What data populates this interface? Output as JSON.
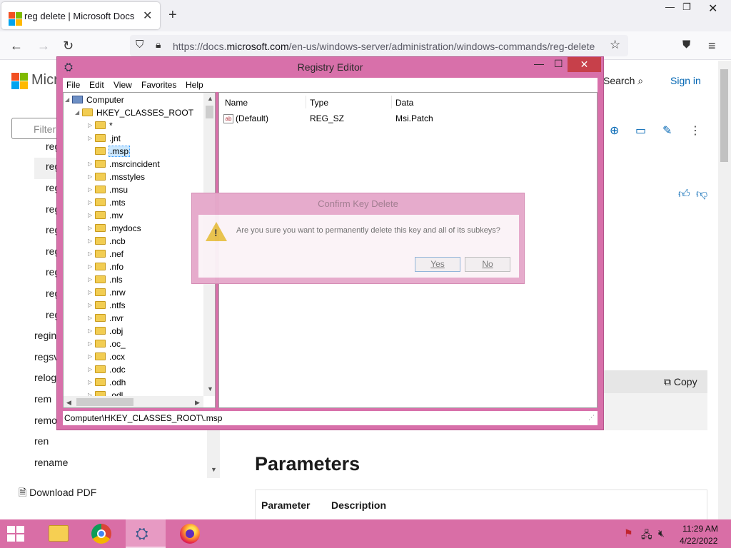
{
  "browser": {
    "tab_title": "reg delete | Microsoft Docs",
    "url_prefix": "https://docs.",
    "url_domain": "microsoft.com",
    "url_path": "/en-us/windows-server/administration/windows-commands/reg-delete"
  },
  "docs": {
    "brand": "Micr",
    "search_label": "Search",
    "signin_label": "Sign in",
    "filter_placeholder": "Filter",
    "toc_items": [
      "reg",
      "reg",
      "reg",
      "reg",
      "reg",
      "reg",
      "reg",
      "reg",
      "reg",
      "regini",
      "regsvr",
      "relog",
      "rem",
      "remo",
      "ren",
      "rename"
    ],
    "download_pdf": "Download PDF",
    "copy_label": "Copy",
    "parameters_heading": "Parameters",
    "table_headers": [
      "Parameter",
      "Description"
    ]
  },
  "regedit": {
    "title": "Registry Editor",
    "menu": [
      "File",
      "Edit",
      "View",
      "Favorites",
      "Help"
    ],
    "tree_root": "Computer",
    "tree_hive": "HKEY_CLASSES_ROOT",
    "tree_keys": [
      "*",
      ".jnt",
      ".msp",
      ".msrcincident",
      ".msstyles",
      ".msu",
      ".mts",
      ".mv",
      ".mydocs",
      ".ncb",
      ".nef",
      ".nfo",
      ".nls",
      ".nrw",
      ".ntfs",
      ".nvr",
      ".obj",
      ".oc_",
      ".ocx",
      ".odc",
      ".odh",
      ".odl"
    ],
    "selected_key": ".msp",
    "columns": [
      "Name",
      "Type",
      "Data"
    ],
    "values": [
      {
        "name": "(Default)",
        "type": "REG_SZ",
        "data": "Msi.Patch"
      }
    ],
    "status_path": "Computer\\HKEY_CLASSES_ROOT\\.msp"
  },
  "confirm_dialog": {
    "title": "Confirm Key Delete",
    "message": "Are you sure you want to permanently delete this key and all of its subkeys?",
    "yes_label": "Yes",
    "no_label": "No"
  },
  "taskbar": {
    "time": "11:29 AM",
    "date": "4/22/2022"
  },
  "colors": {
    "window_accent": "#d870aa",
    "taskbar": "#d96ea6",
    "link": "#0065b3"
  }
}
